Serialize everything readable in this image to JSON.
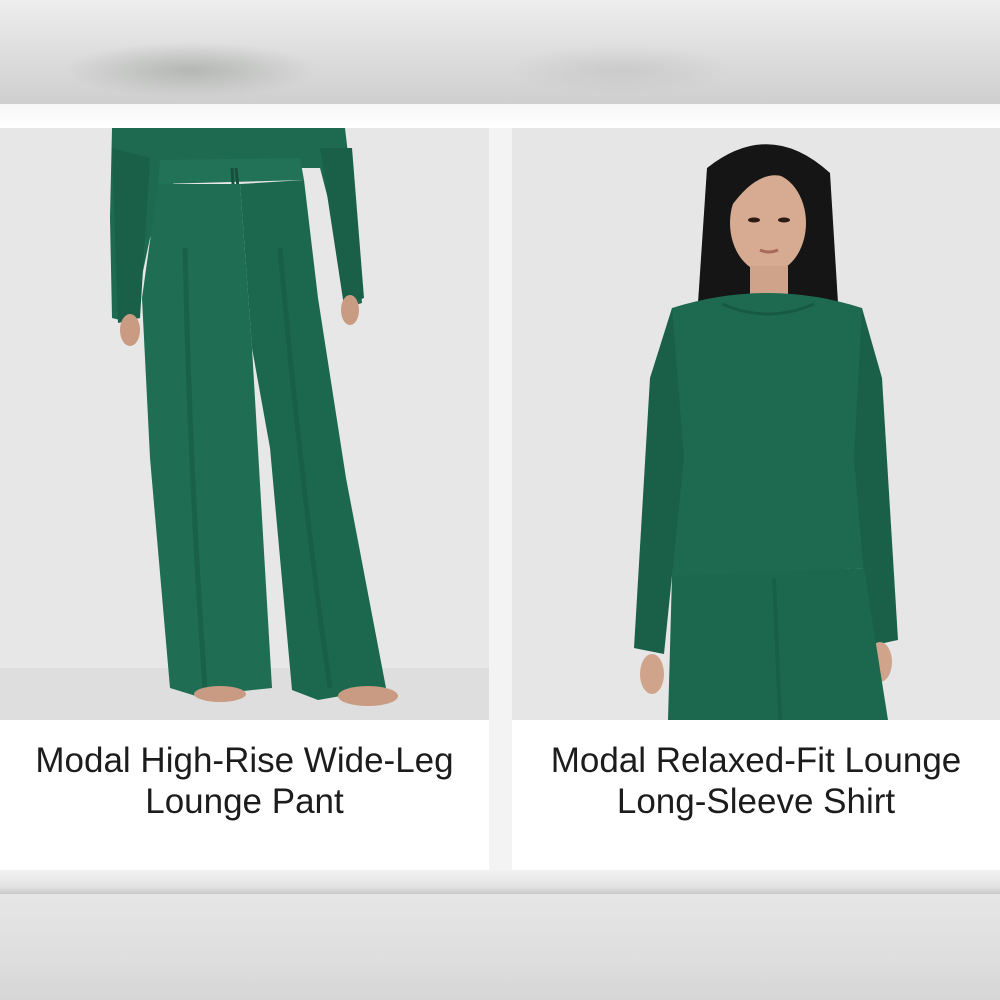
{
  "products": [
    {
      "title": "Modal High-Rise Wide-Leg Lounge Pant",
      "image_subject": "model wearing green wide-leg lounge pants"
    },
    {
      "title": "Modal Relaxed-Fit Lounge Long-Sleeve Shirt",
      "image_subject": "model wearing green long-sleeve lounge shirt"
    }
  ],
  "colors": {
    "garment_green": "#1f6b52",
    "background_gray": "#e6e6e6",
    "text": "#1c1c1c"
  }
}
